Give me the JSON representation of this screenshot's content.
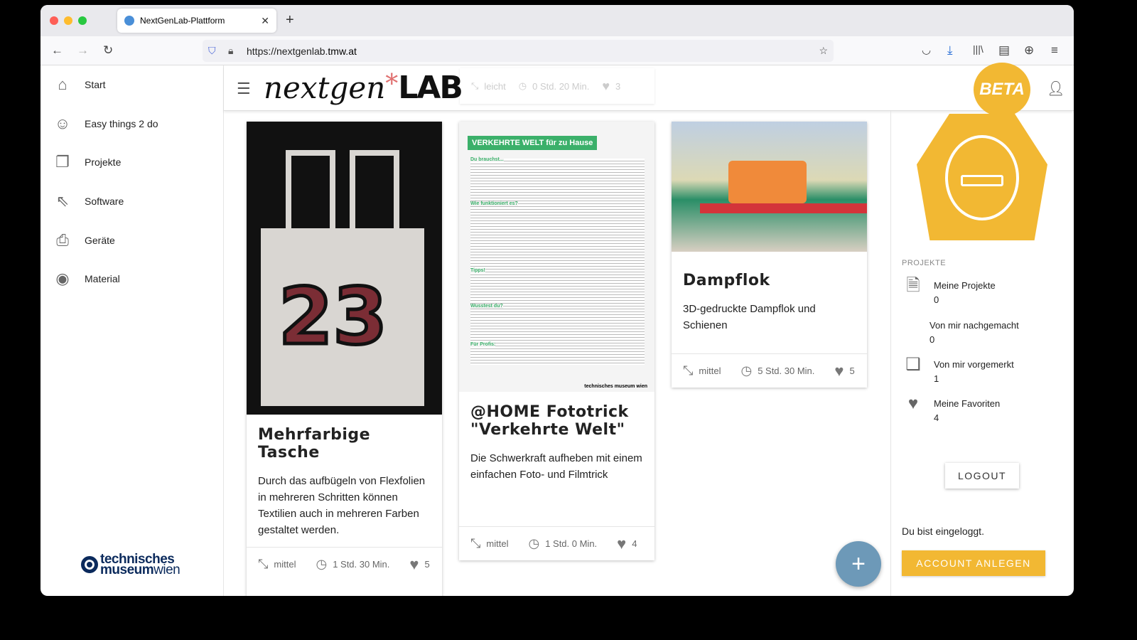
{
  "browser": {
    "tab_title": "NextGenLab-Plattform",
    "url_prefix": "https://nextgenlab.",
    "url_host": "tmw.at"
  },
  "sidebar": {
    "items": [
      {
        "label": "Start",
        "icon": "home-icon"
      },
      {
        "label": "Easy things 2 do",
        "icon": "smiley-icon"
      },
      {
        "label": "Projekte",
        "icon": "copy-icon"
      },
      {
        "label": "Software",
        "icon": "cursor-click-icon"
      },
      {
        "label": "Geräte",
        "icon": "printer-icon"
      },
      {
        "label": "Material",
        "icon": "filament-icon"
      }
    ],
    "logo_bold": "technisches",
    "logo_line2a": "museum",
    "logo_line2b": "wien"
  },
  "header": {
    "logo_text": "nextgen",
    "logo_lab": "LAB",
    "ghost": {
      "difficulty": "leicht",
      "time": "0 Std. 20 Min.",
      "likes": "3"
    },
    "beta": "BETA"
  },
  "cards": [
    {
      "title": "Mehrfarbige Tasche",
      "desc": "Durch das aufbügeln von Flexfolien in mehreren Schritten können Textilien auch in mehreren Farben gestaltet werden.",
      "difficulty": "mittel",
      "time": "1 Std. 30 Min.",
      "likes": "5"
    },
    {
      "title": "@HOME Fototrick \"Verkehrte Welt\"",
      "desc": "Die Schwerkraft aufheben mit einem einfachen Foto- und Filmtrick",
      "difficulty": "mittel",
      "time": "1 Std. 0 Min.",
      "likes": "4",
      "poster_title": "VERKEHRTE WELT für zu Hause",
      "poster_sections": [
        "Du brauchst...",
        "Wie funktioniert es?",
        "Tipps!",
        "Wusstest du?",
        "Für Profis:"
      ],
      "poster_logo": "technisches museum wien"
    },
    {
      "title": "Dampflok",
      "desc": "3D-gedruckte Dampflok und Schienen",
      "difficulty": "mittel",
      "time": "5 Std. 30 Min.",
      "likes": "5"
    }
  ],
  "right": {
    "heading": "PROJEKTE",
    "items": [
      {
        "label": "Meine Projekte",
        "count": "0"
      },
      {
        "label": "Von mir nachgemacht",
        "count": "0"
      },
      {
        "label": "Von mir vorgemerkt",
        "count": "1"
      },
      {
        "label": "Meine Favoriten",
        "count": "4"
      }
    ],
    "logout": "LOGOUT",
    "status": "Du bist eingeloggt.",
    "account": "ACCOUNT ANLEGEN"
  },
  "colors": {
    "accent": "#f2b833",
    "fab": "#6d99b8",
    "green": "#3bb06a"
  }
}
